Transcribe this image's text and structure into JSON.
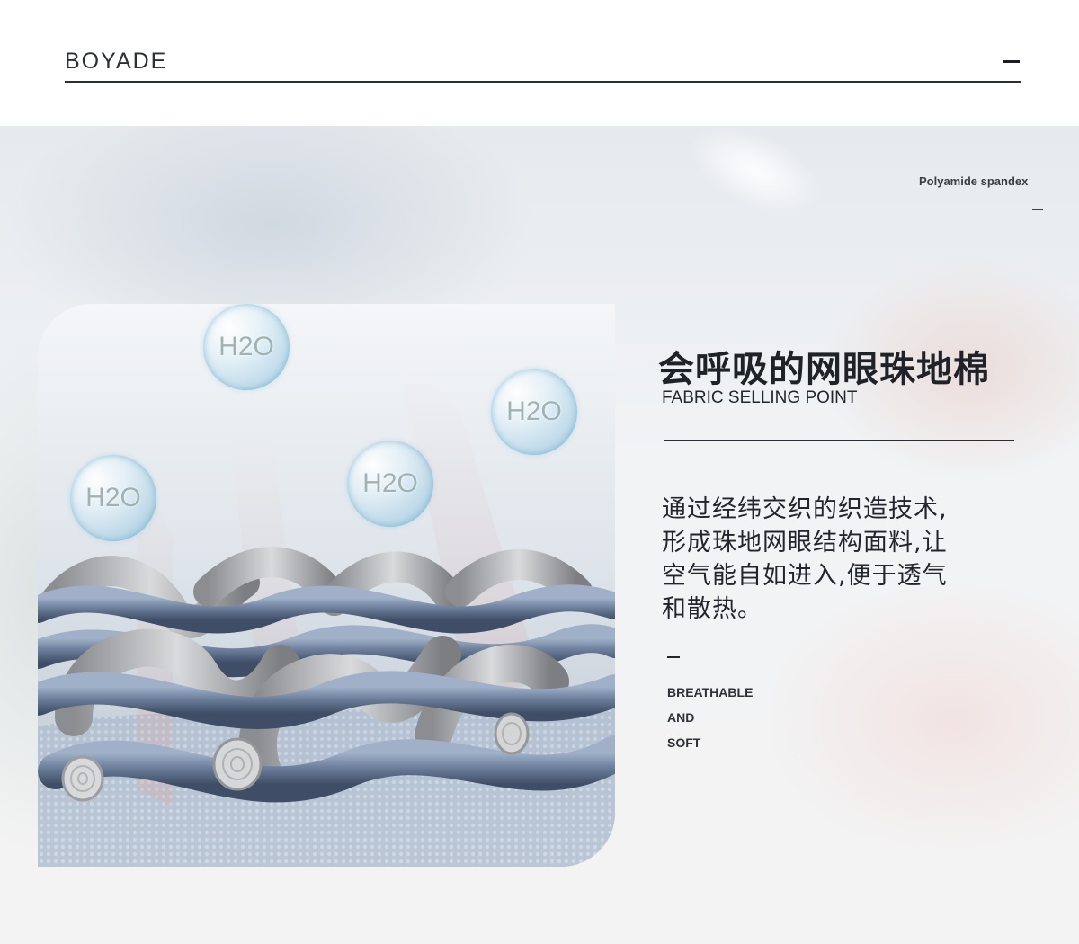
{
  "header": {
    "brand": "BOYADE"
  },
  "hero": {
    "material_label": "Polyamide spandex",
    "bubbles": [
      "H2O",
      "H2O",
      "H2O",
      "H2O"
    ],
    "title_cn": "会呼吸的网眼珠地棉",
    "title_en": "FABRIC SELLING POINT",
    "description_lines": [
      "通过经纬交织的织造技术,",
      "形成珠地网眼结构面料,让",
      "空气能自如进入,便于透气",
      "和散热。"
    ],
    "features": [
      "BREATHABLE",
      "AND",
      "SOFT"
    ]
  },
  "colors": {
    "text_dark": "#1f2329",
    "fiber_blue": "#6d7f9c",
    "fiber_grey": "#a7a9ad",
    "bubble_tint": "#9fc6dc"
  },
  "icons": [
    "water-bubble-icon",
    "fabric-weave-illustration"
  ]
}
